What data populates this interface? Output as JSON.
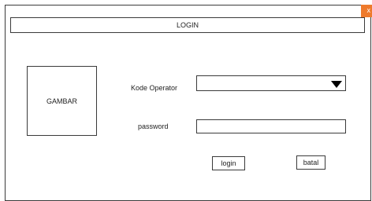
{
  "window": {
    "close_label": "x",
    "title": "LOGIN"
  },
  "image_placeholder": "GAMBAR",
  "form": {
    "operator_label": "Kode Operator",
    "operator_value": "",
    "password_label": "password",
    "password_value": ""
  },
  "buttons": {
    "login_label": "login",
    "cancel_label": "batal"
  },
  "colors": {
    "close_button": "#ee7a2c",
    "border": "#3a3a3a"
  }
}
